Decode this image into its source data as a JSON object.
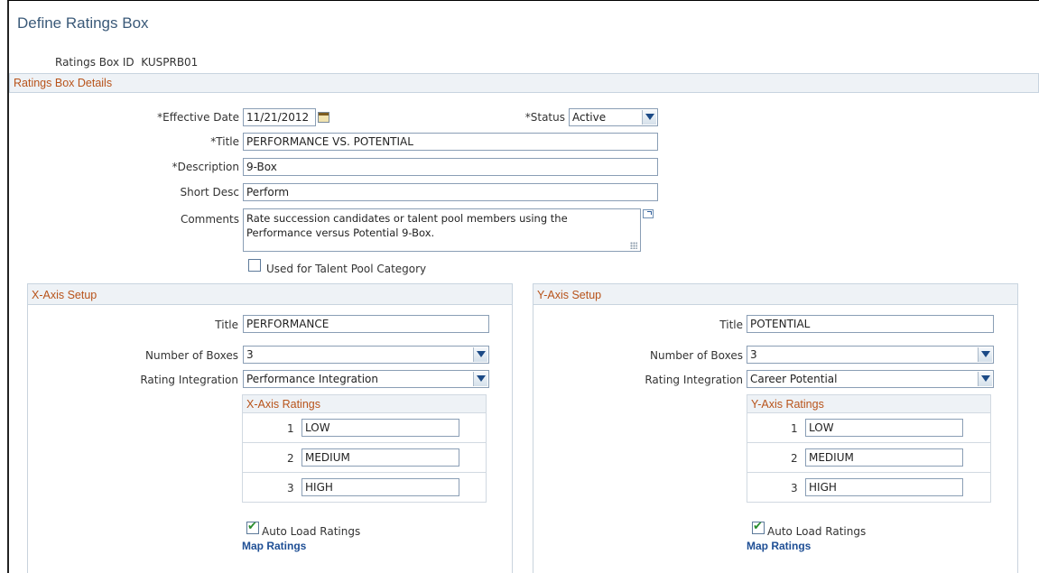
{
  "page": {
    "title": "Define Ratings Box"
  },
  "ratings_box_id": {
    "label": "Ratings Box ID",
    "value": "KUSPRB01"
  },
  "details": {
    "heading": "Ratings Box Details",
    "effective_date": {
      "label": "*Effective Date",
      "value": "11/21/2012",
      "icon": "calendar-icon"
    },
    "status": {
      "label": "*Status",
      "value": "Active"
    },
    "title": {
      "label": "*Title",
      "value": "PERFORMANCE VS. POTENTIAL"
    },
    "description": {
      "label": "*Description",
      "value": "9-Box"
    },
    "short_desc": {
      "label": "Short Desc",
      "value": "Perform"
    },
    "comments": {
      "label": "Comments",
      "line1": "Rate succession candidates or talent pool members using the",
      "line2": "Performance versus Potential 9-Box."
    },
    "talent_pool": {
      "label": "Used for Talent Pool Category",
      "checked": false
    }
  },
  "x_axis": {
    "heading": "X-Axis Setup",
    "title": {
      "label": "Title",
      "value": "PERFORMANCE"
    },
    "number_of_boxes": {
      "label": "Number of Boxes",
      "value": "3"
    },
    "rating_integration": {
      "label": "Rating Integration",
      "value": "Performance Integration"
    },
    "ratings": {
      "heading": "X-Axis Ratings",
      "rows": [
        {
          "num": "1",
          "value": "LOW"
        },
        {
          "num": "2",
          "value": "MEDIUM"
        },
        {
          "num": "3",
          "value": "HIGH"
        }
      ]
    },
    "auto_load": {
      "label": "Auto Load Ratings",
      "checked": true
    },
    "map_ratings": "Map Ratings"
  },
  "y_axis": {
    "heading": "Y-Axis Setup",
    "title": {
      "label": "Title",
      "value": "POTENTIAL"
    },
    "number_of_boxes": {
      "label": "Number of Boxes",
      "value": "3"
    },
    "rating_integration": {
      "label": "Rating Integration",
      "value": "Career Potential"
    },
    "ratings": {
      "heading": "Y-Axis Ratings",
      "rows": [
        {
          "num": "1",
          "value": "LOW"
        },
        {
          "num": "2",
          "value": "MEDIUM"
        },
        {
          "num": "3",
          "value": "HIGH"
        }
      ]
    },
    "auto_load": {
      "label": "Auto Load Ratings",
      "checked": true
    },
    "map_ratings": "Map Ratings"
  },
  "colors": {
    "title": "#3b5a79",
    "section_heading": "#b8531a",
    "link": "#1f4f95",
    "check": "#2a8d2e"
  }
}
